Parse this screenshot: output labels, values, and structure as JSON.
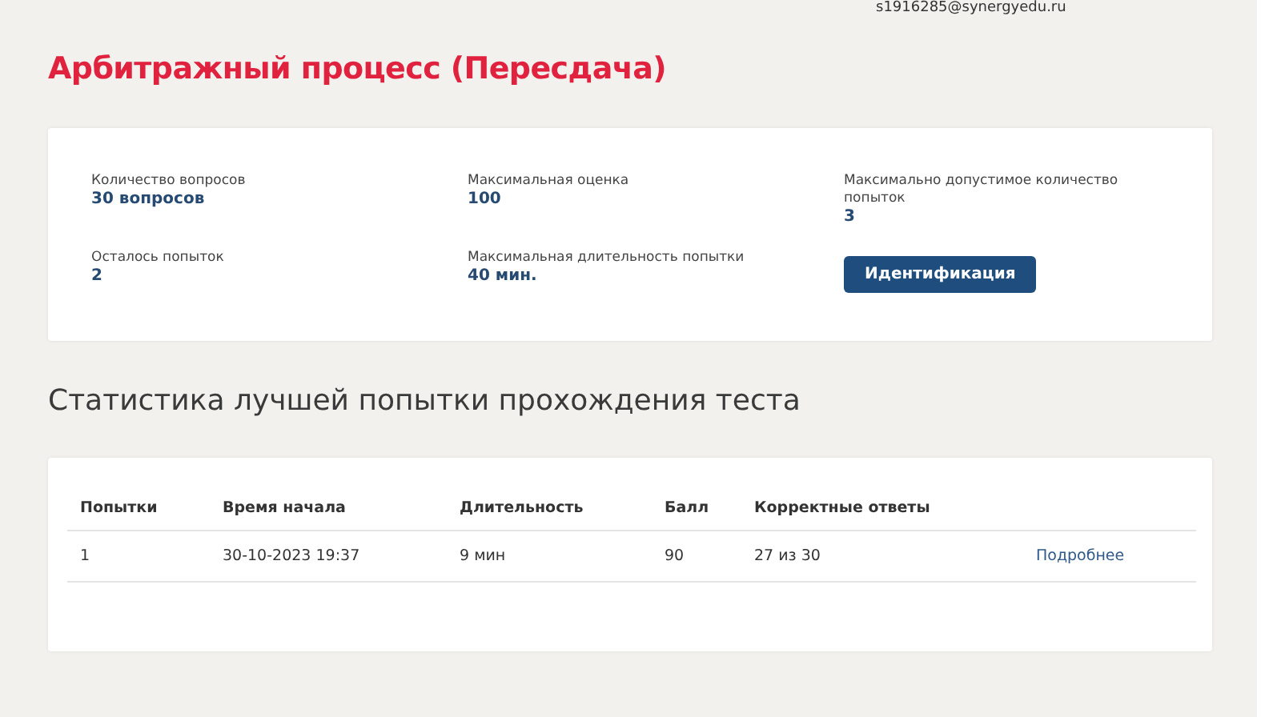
{
  "top_bar": {
    "email": "s1916285@synergyedu.ru"
  },
  "title": "Арбитражный процесс (Пересдача)",
  "info": [
    {
      "label": "Количество вопросов",
      "value": "30 вопросов"
    },
    {
      "label": "Максимальная оценка",
      "value": "100"
    },
    {
      "label": "Максимально допустимое количество попыток",
      "value": "3"
    },
    {
      "label": "Осталось попыток",
      "value": "2"
    },
    {
      "label": "Максимальная длительность попытки",
      "value": "40 мин."
    }
  ],
  "identify_button": "Идентификация",
  "stats_heading": "Статистика лучшей попытки прохождения теста",
  "table": {
    "columns": [
      "Попытки",
      "Время начала",
      "Длительность",
      "Балл",
      "Корректные ответы"
    ],
    "rows": [
      {
        "cells": [
          "1",
          "30-10-2023 19:37",
          "9 мин",
          "90",
          "27 из 30"
        ],
        "link": "Подробнее"
      }
    ]
  }
}
